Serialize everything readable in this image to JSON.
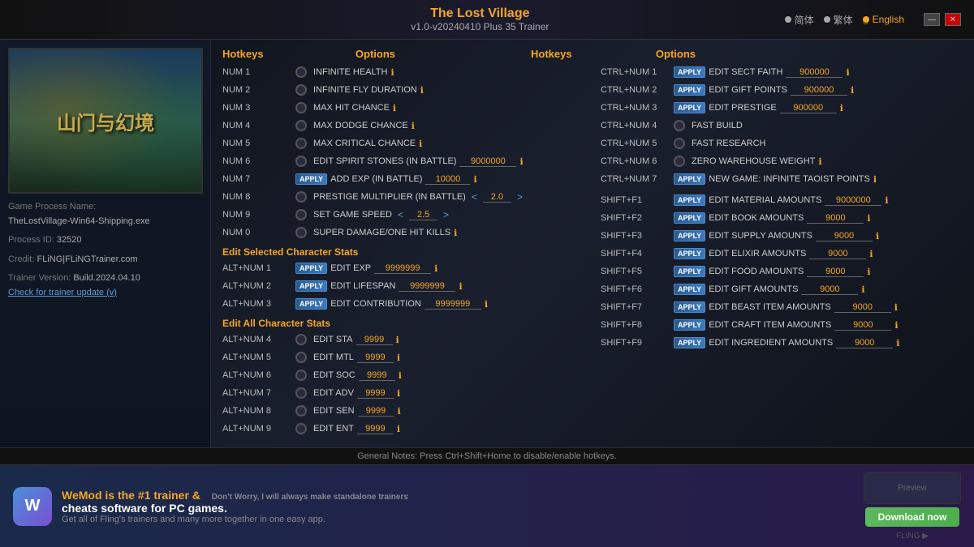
{
  "header": {
    "game_name": "The Lost Village",
    "version": "v1.0-v20240410 Plus 35 Trainer",
    "languages": [
      {
        "code": "zh_simple",
        "label": "简体",
        "dot": "filled",
        "active": false
      },
      {
        "code": "zh_trad",
        "label": "繁体",
        "dot": "filled",
        "active": false
      },
      {
        "code": "en",
        "label": "English",
        "dot": "active",
        "active": true
      }
    ],
    "win_minimize": "—",
    "win_close": "✕"
  },
  "sidebar": {
    "game_image_text": "山门与幻境",
    "process_label": "Game Process Name:",
    "process_value": "TheLostVillage-Win64-Shipping.exe",
    "pid_label": "Process ID:",
    "pid_value": "32520",
    "credit_label": "Credit:",
    "credit_value": "FLiNG|FLiNGTrainer.com",
    "trainer_label": "Trainer Version:",
    "trainer_value": "Build.2024.04.10",
    "update_link": "Check for trainer update (v)"
  },
  "columns": {
    "hotkeys": "Hotkeys",
    "options": "Options"
  },
  "hotkeys": [
    {
      "key": "NUM 1",
      "toggle": false,
      "label": "INFINITE HEALTH",
      "info": true,
      "apply": false,
      "value": null,
      "nav": null
    },
    {
      "key": "NUM 2",
      "toggle": false,
      "label": "INFINITE FLY DURATION",
      "info": true,
      "apply": false,
      "value": null,
      "nav": null
    },
    {
      "key": "NUM 3",
      "toggle": false,
      "label": "MAX HIT CHANCE",
      "info": true,
      "apply": false,
      "value": null,
      "nav": null
    },
    {
      "key": "NUM 4",
      "toggle": false,
      "label": "MAX DODGE CHANCE",
      "info": true,
      "apply": false,
      "value": null,
      "nav": null
    },
    {
      "key": "NUM 5",
      "toggle": false,
      "label": "MAX CRITICAL CHANCE",
      "info": true,
      "apply": false,
      "value": null,
      "nav": null
    },
    {
      "key": "NUM 6",
      "toggle": false,
      "label": "EDIT SPIRIT STONES (IN BATTLE)",
      "info": true,
      "apply": false,
      "value": "9000000",
      "nav": null
    },
    {
      "key": "NUM 7",
      "toggle": false,
      "label": "ADD EXP (IN BATTLE)",
      "info": true,
      "apply": true,
      "value": "10000",
      "nav": null
    },
    {
      "key": "NUM 8",
      "toggle": false,
      "label": "PRESTIGE MULTIPLIER (IN BATTLE)",
      "info": false,
      "apply": false,
      "value": "2.0",
      "nav": true
    },
    {
      "key": "NUM 9",
      "toggle": false,
      "label": "SET GAME SPEED",
      "info": false,
      "apply": false,
      "value": "2.5",
      "nav": "both"
    },
    {
      "key": "NUM 0",
      "toggle": false,
      "label": "SUPER DAMAGE/ONE HIT KILLS",
      "info": true,
      "apply": false,
      "value": null,
      "nav": null
    }
  ],
  "ctrl_hotkeys": [
    {
      "key": "CTRL+NUM 1",
      "label": "EDIT SECT FAITH",
      "info": true,
      "apply": true,
      "value": "900000"
    },
    {
      "key": "CTRL+NUM 2",
      "label": "EDIT GIFT POINTS",
      "info": true,
      "apply": true,
      "value": "900000"
    },
    {
      "key": "CTRL+NUM 3",
      "label": "EDIT PRESTIGE",
      "info": true,
      "apply": true,
      "value": "900000"
    },
    {
      "key": "CTRL+NUM 4",
      "label": "FAST BUILD",
      "info": false,
      "apply": false,
      "value": null
    },
    {
      "key": "CTRL+NUM 5",
      "label": "FAST RESEARCH",
      "info": false,
      "apply": false,
      "value": null
    },
    {
      "key": "CTRL+NUM 6",
      "label": "ZERO WAREHOUSE WEIGHT",
      "info": true,
      "apply": false,
      "value": null
    },
    {
      "key": "CTRL+NUM 7",
      "label": "NEW GAME: INFINITE TAOIST POINTS",
      "info": true,
      "apply": true,
      "value": null
    }
  ],
  "shift_hotkeys": [
    {
      "key": "SHIFT+F1",
      "label": "EDIT MATERIAL AMOUNTS",
      "info": true,
      "apply": true,
      "value": "9000000"
    },
    {
      "key": "SHIFT+F2",
      "label": "EDIT BOOK AMOUNTS",
      "info": true,
      "apply": true,
      "value": "9000"
    },
    {
      "key": "SHIFT+F3",
      "label": "EDIT SUPPLY AMOUNTS",
      "info": true,
      "apply": true,
      "value": "9000"
    },
    {
      "key": "SHIFT+F4",
      "label": "EDIT ELIXIR AMOUNTS",
      "info": true,
      "apply": true,
      "value": "9000"
    },
    {
      "key": "SHIFT+F5",
      "label": "EDIT FOOD AMOUNTS",
      "info": true,
      "apply": true,
      "value": "9000"
    },
    {
      "key": "SHIFT+F6",
      "label": "EDIT GIFT AMOUNTS",
      "info": true,
      "apply": true,
      "value": "9000"
    },
    {
      "key": "SHIFT+F7",
      "label": "EDIT BEAST ITEM AMOUNTS",
      "info": true,
      "apply": true,
      "value": "9000"
    },
    {
      "key": "SHIFT+F8",
      "label": "EDIT CRAFT ITEM AMOUNTS",
      "info": true,
      "apply": true,
      "value": "9000"
    },
    {
      "key": "SHIFT+F9",
      "label": "EDIT INGREDIENT AMOUNTS",
      "info": true,
      "apply": true,
      "value": "9000"
    }
  ],
  "edit_char_section": "Edit Selected Character Stats",
  "alt_hotkeys": [
    {
      "key": "ALT+NUM 1",
      "label": "EDIT EXP",
      "info": true,
      "apply": true,
      "value": "9999999"
    },
    {
      "key": "ALT+NUM 2",
      "label": "EDIT LIFESPAN",
      "info": true,
      "apply": true,
      "value": "9999999"
    },
    {
      "key": "ALT+NUM 3",
      "label": "EDIT CONTRIBUTION",
      "info": true,
      "apply": true,
      "value": "9999999"
    }
  ],
  "edit_all_section": "Edit All Character Stats",
  "alt4_hotkeys": [
    {
      "key": "ALT+NUM 4",
      "label": "EDIT STA",
      "info": true,
      "apply": false,
      "value": "9999"
    },
    {
      "key": "ALT+NUM 5",
      "label": "EDIT MTL",
      "info": true,
      "apply": false,
      "value": "9999"
    },
    {
      "key": "ALT+NUM 6",
      "label": "EDIT SOC",
      "info": true,
      "apply": false,
      "value": "9999"
    },
    {
      "key": "ALT+NUM 7",
      "label": "EDIT ADV",
      "info": true,
      "apply": false,
      "value": "9999"
    },
    {
      "key": "ALT+NUM 8",
      "label": "EDIT SEN",
      "info": true,
      "apply": false,
      "value": "9999"
    },
    {
      "key": "ALT+NUM 9",
      "label": "EDIT ENT",
      "info": true,
      "apply": false,
      "value": "9999"
    }
  ],
  "footer": {
    "general_notes": "General Notes: Press Ctrl+Shift+Home to disable/enable hotkeys."
  },
  "ad": {
    "logo_text": "W",
    "title_part1": "WeMod is the #1 trainer &",
    "title_part2": "cheats software for PC games.",
    "subtitle": "Get all of Fling's trainers and many more together in one easy app.",
    "disclaimer": "Don't Worry, I will always make standalone trainers",
    "download_label": "Download now",
    "fling_credit": "FLING ▶"
  }
}
